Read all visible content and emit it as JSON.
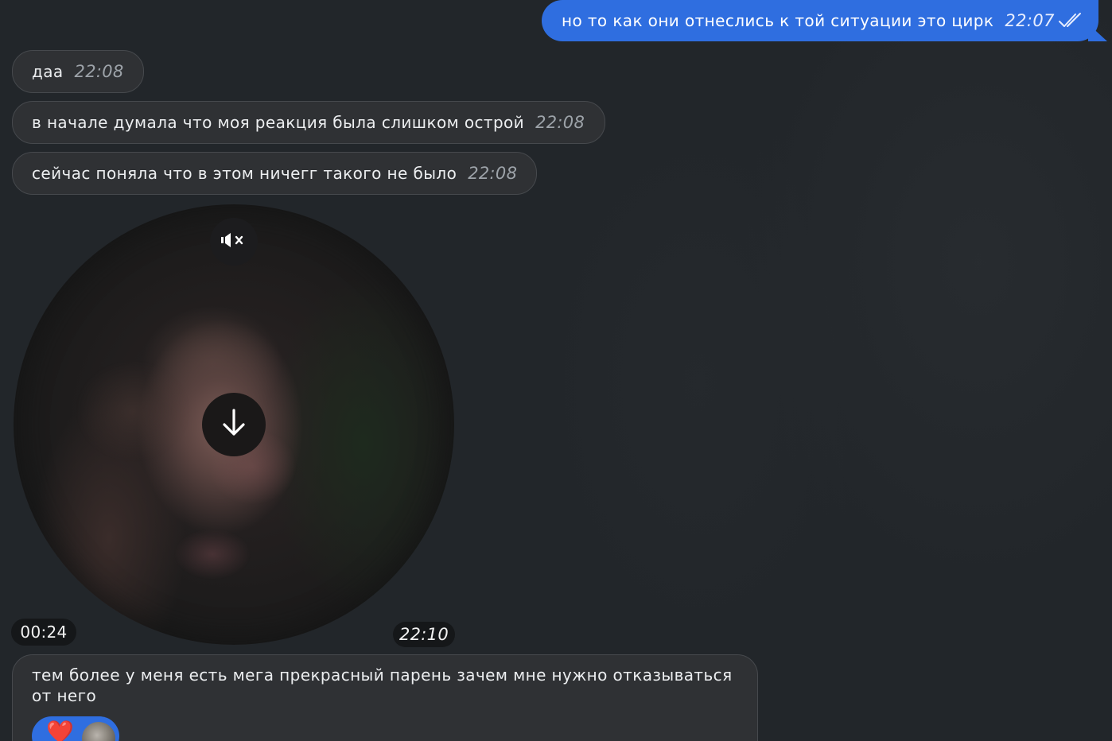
{
  "messages": {
    "outgoing_1": {
      "text": "но то как они отнеслись к той ситуации это цирк",
      "time": "22:07",
      "status_icon": "double-check-icon"
    },
    "incoming_1": {
      "text": "даа",
      "time": "22:08"
    },
    "incoming_2": {
      "text": "в начале думала что моя реакция была слишком острой",
      "time": "22:08"
    },
    "incoming_3": {
      "text": "сейчас поняла что в этом ничегг такого не было",
      "time": "22:08"
    },
    "video_note": {
      "duration": "00:24",
      "time": "22:10",
      "mute_icon": "speaker-muted-icon",
      "download_icon": "download-arrow-icon"
    },
    "incoming_4": {
      "text": "тем более у меня есть мега прекрасный парень зачем мне нужно отказываться от него",
      "reactions": [
        {
          "emoji": "❤️",
          "icon": "heart-icon"
        }
      ]
    }
  },
  "colors": {
    "background": "#22262a",
    "incoming_bubble": "#2f3134",
    "outgoing_bubble": "#2f6ee0",
    "time_text": "#9da3a9"
  }
}
